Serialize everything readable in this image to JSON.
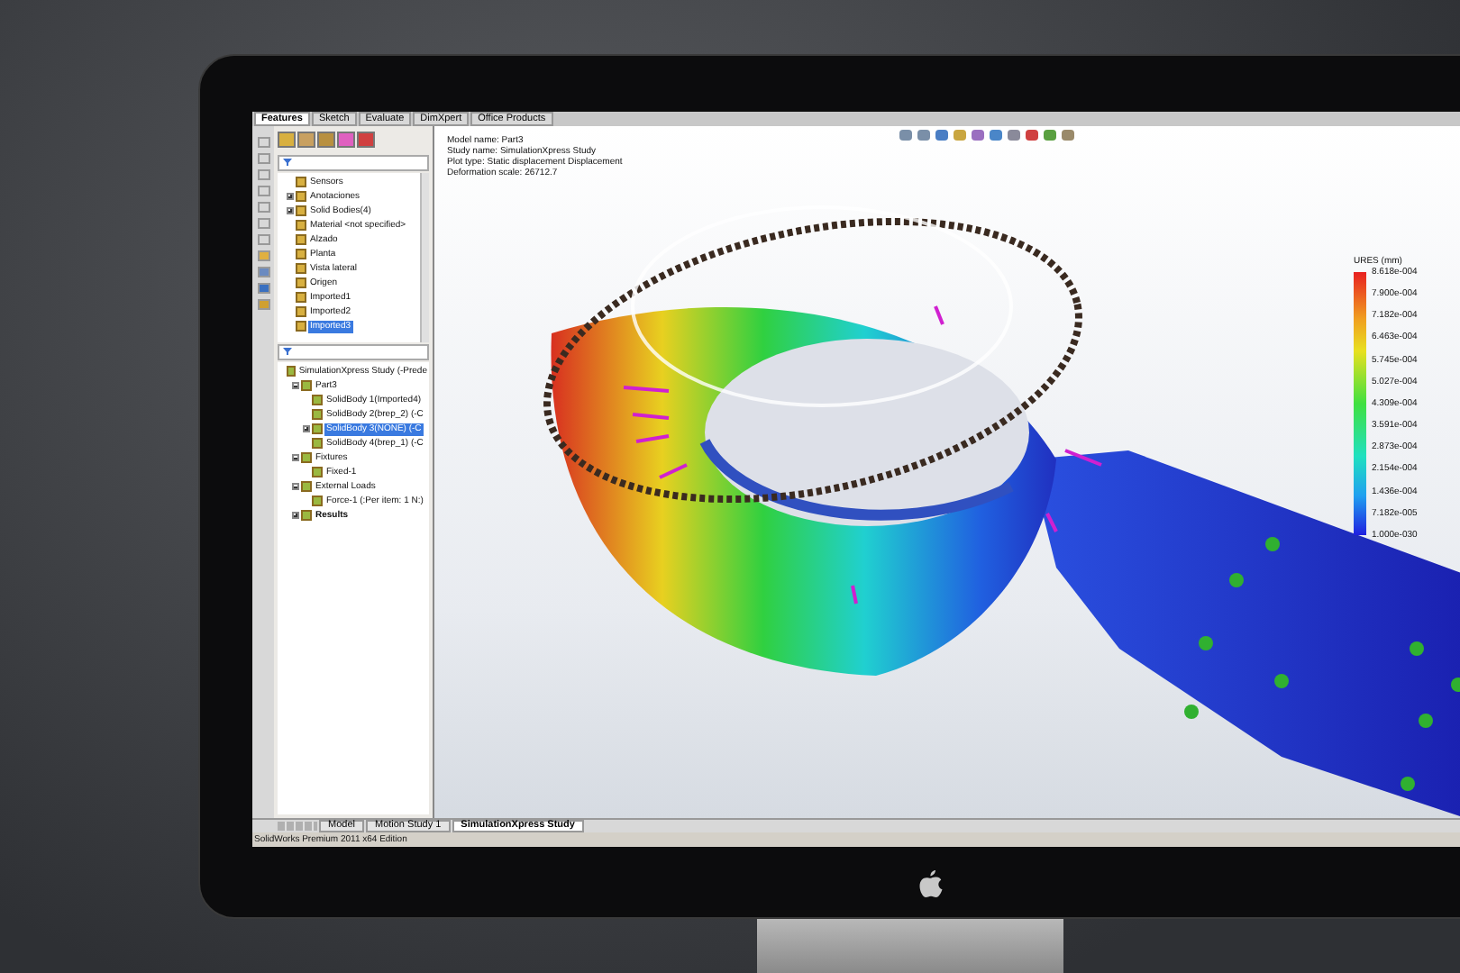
{
  "feature_tabs": [
    {
      "label": "Features",
      "selected": true
    },
    {
      "label": "Sketch",
      "selected": false
    },
    {
      "label": "Evaluate",
      "selected": false
    },
    {
      "label": "DimXpert",
      "selected": false
    },
    {
      "label": "Office Products",
      "selected": false
    }
  ],
  "feature_tree": {
    "items": [
      {
        "label": "Sensors",
        "selected": false
      },
      {
        "label": "Anotaciones",
        "selected": false,
        "expanded": false
      },
      {
        "label": "Solid Bodies(4)",
        "selected": false,
        "expanded": false
      },
      {
        "label": "Material <not specified>",
        "selected": false
      },
      {
        "label": "Alzado",
        "selected": false
      },
      {
        "label": "Planta",
        "selected": false
      },
      {
        "label": "Vista lateral",
        "selected": false
      },
      {
        "label": "Origen",
        "selected": false
      },
      {
        "label": "Imported1",
        "selected": false
      },
      {
        "label": "Imported2",
        "selected": false
      },
      {
        "label": "Imported3",
        "selected": true
      }
    ]
  },
  "study_tree": {
    "items": [
      {
        "label": "SimulationXpress Study (-Prede",
        "selected": false,
        "children": [
          {
            "label": "Part3",
            "selected": false,
            "expanded": true,
            "children": [
              {
                "label": "SolidBody 1(Imported4)",
                "selected": false
              },
              {
                "label": "SolidBody 2(brep_2) (-C",
                "selected": false
              },
              {
                "label": "SolidBody 3(NONE) (-C",
                "selected": true,
                "expanded": false
              },
              {
                "label": "SolidBody 4(brep_1) (-C",
                "selected": false
              }
            ]
          },
          {
            "label": "Fixtures",
            "selected": false,
            "expanded": true,
            "children": [
              {
                "label": "Fixed-1",
                "selected": false
              }
            ]
          },
          {
            "label": "External Loads",
            "selected": false,
            "expanded": true,
            "children": [
              {
                "label": "Force-1 (:Per item: 1 N:)",
                "selected": false
              }
            ]
          },
          {
            "label": "Results",
            "selected": false,
            "expanded": false,
            "bold": true
          }
        ]
      }
    ]
  },
  "viewport": {
    "info": [
      "Model name: Part3",
      "Study name: SimulationXpress Study",
      "Plot type: Static displacement Displacement",
      "Deformation scale: 26712.7"
    ],
    "legend": {
      "title": "URES (mm)",
      "labels": [
        "8.618e-004",
        "7.900e-004",
        "7.182e-004",
        "6.463e-004",
        "5.745e-004",
        "5.027e-004",
        "4.309e-004",
        "3.591e-004",
        "2.873e-004",
        "2.154e-004",
        "1.436e-004",
        "7.182e-005",
        "1.000e-030"
      ]
    }
  },
  "bottom_tabs": [
    {
      "label": "Model",
      "selected": false
    },
    {
      "label": "Motion Study 1",
      "selected": false
    },
    {
      "label": "SimulationXpress Study",
      "selected": true
    }
  ],
  "status_bar": "SolidWorks Premium 2011 x64 Edition"
}
